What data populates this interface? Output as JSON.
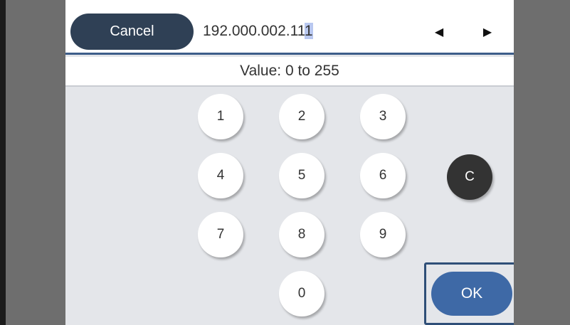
{
  "header": {
    "cancel_label": "Cancel",
    "ip_prefix": "192.000.002.11",
    "ip_cursor_char": "1",
    "left_arrow": "◀",
    "right_arrow": "▶"
  },
  "range_text": "Value: 0 to 255",
  "keypad": {
    "k1": "1",
    "k2": "2",
    "k3": "3",
    "k4": "4",
    "k5": "5",
    "k6": "6",
    "k7": "7",
    "k8": "8",
    "k9": "9",
    "k0": "0",
    "clear": "C"
  },
  "ok_label": "OK"
}
